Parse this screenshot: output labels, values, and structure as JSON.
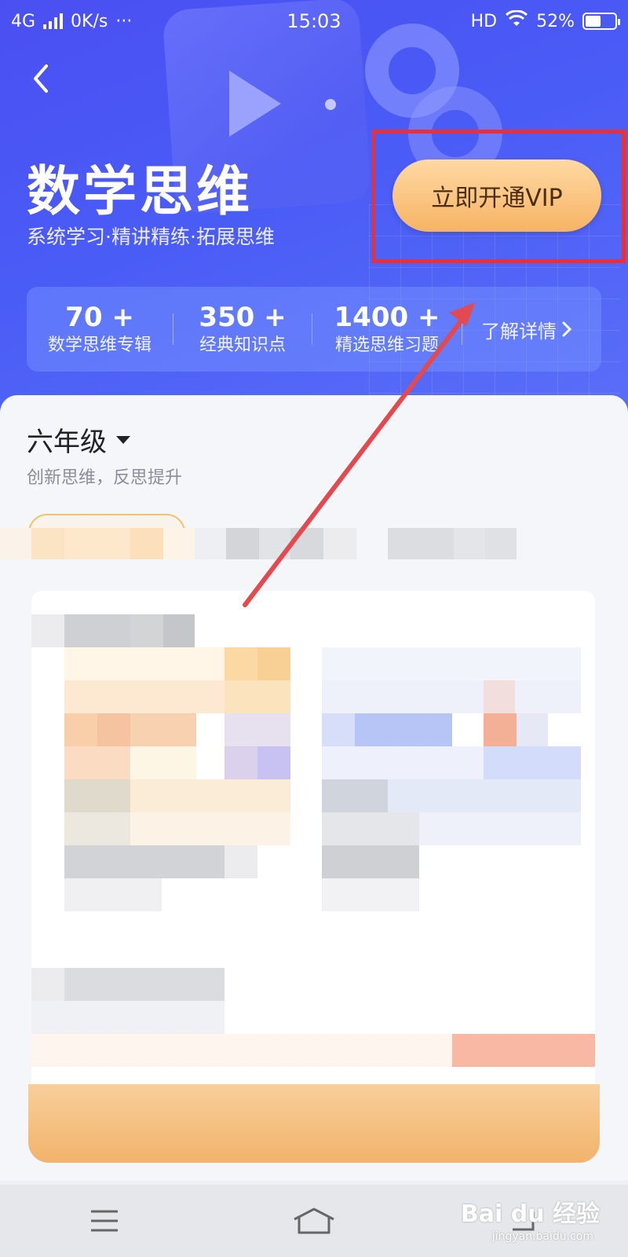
{
  "status_bar": {
    "network": "4G",
    "speed": "0K/s",
    "more": "···",
    "time": "15:03",
    "hd": "HD",
    "battery_text": "52%",
    "battery_level": 0.52
  },
  "header": {
    "back_icon": "chevron-left-icon",
    "title": "数学思维",
    "subtitle": "系统学习·精讲精练·拓展思维",
    "vip_button_label": "立即开通VIP"
  },
  "stats": {
    "items": [
      {
        "value": "70 +",
        "label": "数学思维专辑"
      },
      {
        "value": "350 +",
        "label": "经典知识点"
      },
      {
        "value": "1400 +",
        "label": "精选思维习题"
      }
    ],
    "details_label": "了解详情",
    "details_icon": "chevron-right-icon"
  },
  "grade": {
    "selected": "六年级",
    "description": "创新思维，反思提升"
  },
  "annotation": {
    "highlight_color": "#e8303a",
    "arrow_color": "#e24a4f"
  },
  "nav_bar": {
    "menu_icon": "menu-icon",
    "home_icon": "home-icon",
    "back_icon": "back-icon"
  },
  "watermark": {
    "text": "Bai du 经验",
    "sub": "jingyan.baidu.com"
  },
  "colors": {
    "hero_blue": "#4a55f4",
    "vip_gold": "#f7b365",
    "card_bg": "#f5f6fa"
  }
}
